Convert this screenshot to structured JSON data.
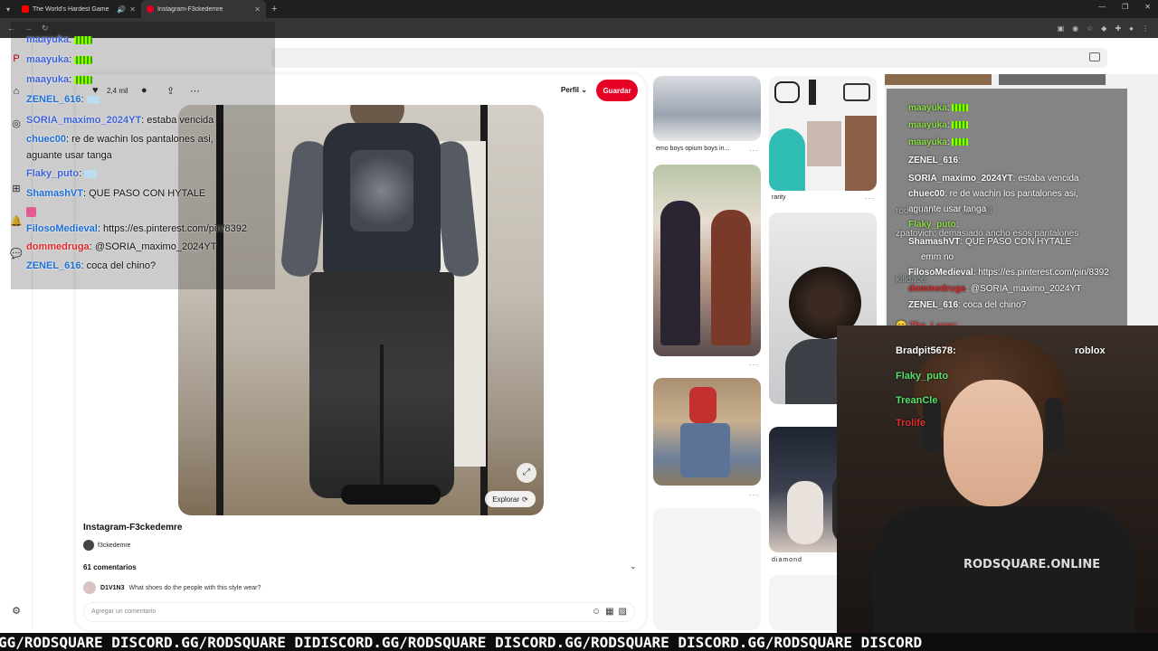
{
  "browser": {
    "tabs": [
      {
        "title": "The World's Hardest Game",
        "active": false
      },
      {
        "title": "Instagram-F3ckedemre",
        "active": true
      }
    ]
  },
  "pin": {
    "likes": "2,4 mil",
    "perfil_label": "Perfil",
    "guardar_label": "Guardar",
    "explorar_label": "Explorar",
    "title": "Instagram-F3ckedemre",
    "author": "f3ckedemre",
    "comments_count": "61 comentarios",
    "comment": {
      "user": "D1V1N3",
      "text": "What shoes do the people with this style wear?"
    },
    "add_comment_placeholder": "Agregar un comentario"
  },
  "feed": {
    "captions": [
      "emo boys opium boys in...",
      "rarity",
      "diamond"
    ]
  },
  "chat_left": [
    {
      "user": "maayuka",
      "text": ""
    },
    {
      "user": "maayuka",
      "text": ""
    },
    {
      "user": "maayuka",
      "text": ""
    },
    {
      "user": "ZENEL_616",
      "text": ""
    },
    {
      "user": "SORIA_maximo_2024YT",
      "text": "estaba vencida"
    },
    {
      "user": "chuec00",
      "text": "re de wachin los pantalones asi,"
    },
    {
      "user": "",
      "text": "aguante usar tanga"
    },
    {
      "user": "Flaky_puto",
      "text": ""
    },
    {
      "user": "ShamashVT",
      "text": "QUE PASO CON HYTALE"
    },
    {
      "user": "FilosoMedieval",
      "text": "https://es.pinterest.com/pin/8392"
    },
    {
      "user": "dommedruga",
      "text": "@SORIA_maximo_2024YT"
    },
    {
      "user": "ZENEL_616",
      "text": "coca del chino?"
    }
  ],
  "chat_right": [
    {
      "user": "maayuka",
      "text": ""
    },
    {
      "user": "maayuka",
      "text": ""
    },
    {
      "user": "maayuka",
      "text": ""
    },
    {
      "user": "ZENEL_616",
      "text": ""
    },
    {
      "user": "SORIA_maximo_2024YT",
      "text": "estaba vencida"
    },
    {
      "user": "chuec00",
      "text": "re de wachin los pantalones asi,"
    },
    {
      "user": "",
      "text": "aguante usar tanga"
    },
    {
      "user": "Flaky_puto",
      "text": ""
    },
    {
      "user": "ShamashVT",
      "text": "QUE PASO CON HYTALE"
    },
    {
      "user": "",
      "text": "emm no"
    },
    {
      "user": "FilosoMedieval",
      "text": "https://es.pinterest.com/pin/8392"
    },
    {
      "user": "dommedruga",
      "text": "@SORIA_maximo_2024YT"
    },
    {
      "user": "ZENEL_616",
      "text": "coca del chino?"
    }
  ],
  "under_chat": {
    "l1": "rodsquare",
    "l2": "dio troll",
    "l3": "zpatovich: demasiado ancho esos pantalones",
    "l4": "killdace:",
    "l5": "The_Layer:"
  },
  "webcam_overlay": [
    {
      "user": "Bradpit5678",
      "text": "roblox"
    },
    {
      "user": "Flaky_puto",
      "text": ""
    },
    {
      "user": "TreanCle",
      "text": ""
    },
    {
      "user": "Trolife",
      "text": ""
    }
  ],
  "webcam": {
    "shirt_text": "RODSQUARE.ONLINE"
  },
  "ticker": "GG/RODSQUARE DISCORD.GG/RODSQUARE DIDISCORD.GG/RODSQUARE DISCORD.GG/RODSQUARE DISCORD.GG/RODSQUARE DISCORD"
}
